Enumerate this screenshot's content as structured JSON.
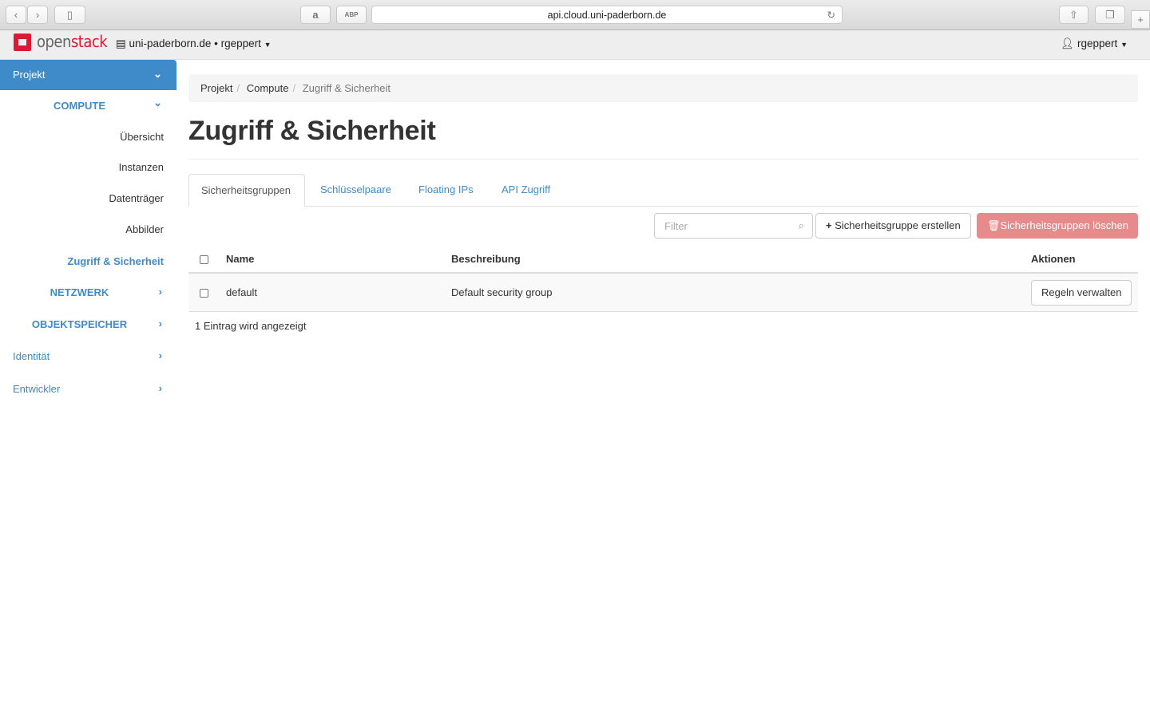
{
  "browser": {
    "url": "api.cloud.uni-paderborn.de",
    "ext_amazon": "a",
    "ext_abp": "ABP"
  },
  "header": {
    "logo_a": "open",
    "logo_b": "stack",
    "project": "uni-paderborn.de • rgeppert",
    "user": "rgeppert"
  },
  "sidebar": {
    "projekt": "Projekt",
    "compute": "COMPUTE",
    "items": [
      "Übersicht",
      "Instanzen",
      "Datenträger",
      "Abbilder",
      "Zugriff & Sicherheit"
    ],
    "netzwerk": "NETZWERK",
    "objektspeicher": "OBJEKTSPEICHER",
    "identitaet": "Identität",
    "entwickler": "Entwickler"
  },
  "breadcrumb": [
    "Projekt",
    "Compute",
    "Zugriff & Sicherheit"
  ],
  "page_title": "Zugriff & Sicherheit",
  "tabs": [
    "Sicherheitsgruppen",
    "Schlüsselpaare",
    "Floating IPs",
    "API Zugriff"
  ],
  "toolbar": {
    "filter_placeholder": "Filter",
    "create": "Sicherheitsgruppe erstellen",
    "delete": "Sicherheitsgruppen löschen"
  },
  "table": {
    "headers": [
      "Name",
      "Beschreibung",
      "Aktionen"
    ],
    "rows": [
      {
        "name": "default",
        "description": "Default security group",
        "action": "Regeln verwalten"
      }
    ],
    "footer": "1 Eintrag wird angezeigt"
  },
  "colors": {
    "accent": "#3f8ac8",
    "danger": "#e68a8c",
    "brand": "#da1a32"
  }
}
